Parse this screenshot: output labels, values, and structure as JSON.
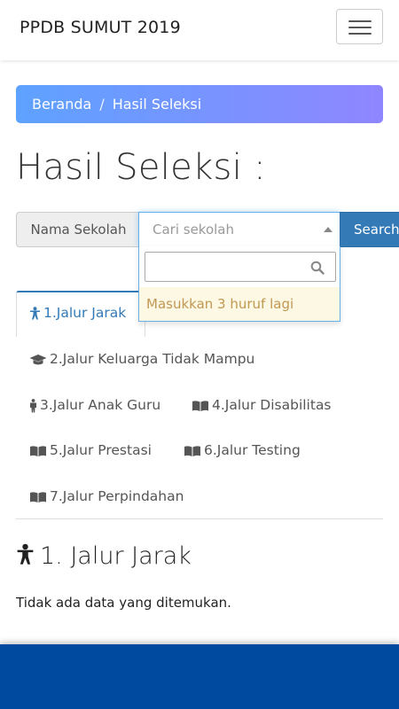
{
  "navbar": {
    "brand": "PPDB SUMUT 2019"
  },
  "breadcrumb": {
    "home": "Beranda",
    "separator": "/",
    "current": "Hasil Seleksi"
  },
  "page": {
    "title": "Hasil Seleksi :"
  },
  "search": {
    "addon_label": "Nama Sekolah",
    "select_placeholder": "Cari sekolah",
    "button_label": "Search",
    "dropdown_message": "Masukkan 3 huruf lagi"
  },
  "tabs": [
    {
      "label": "1.Jalur Jarak",
      "icon": "child-icon",
      "active": true
    },
    {
      "label": "2.Jalur Keluarga Tidak Mampu",
      "icon": "graduation-cap-icon"
    },
    {
      "label": "3.Jalur Anak Guru",
      "icon": "male-icon"
    },
    {
      "label": "4.Jalur Disabilitas",
      "icon": "book-icon"
    },
    {
      "label": "5.Jalur Prestasi",
      "icon": "book-icon"
    },
    {
      "label": "6.Jalur Testing",
      "icon": "book-icon"
    },
    {
      "label": "7.Jalur Perpindahan",
      "icon": "book-icon"
    }
  ],
  "section": {
    "title": "1. Jalur Jarak",
    "empty_message": "Tidak ada data yang ditemukan."
  },
  "colors": {
    "primary": "#337ab7",
    "footer": "#004a9f",
    "warning_bg": "#fcf8e3",
    "warning_text": "#c09853"
  }
}
